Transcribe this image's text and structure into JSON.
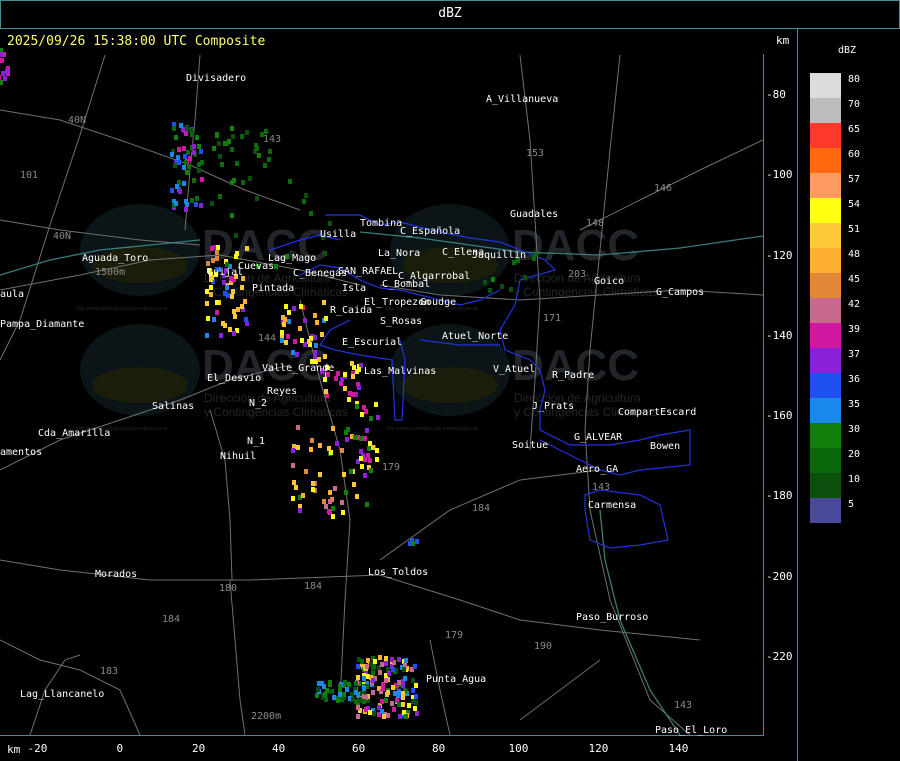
{
  "header": {
    "title": "dBZ"
  },
  "map": {
    "timestamp": "2025/09/26 15:38:00 UTC Composite",
    "y_axis": {
      "unit": "km",
      "ticks": [
        "-80",
        "-100",
        "-120",
        "-140",
        "-160",
        "-180",
        "-200",
        "-220"
      ]
    },
    "x_axis": {
      "unit": "km",
      "ticks": [
        "-20",
        "0",
        "20",
        "40",
        "60",
        "80",
        "100",
        "120",
        "140"
      ]
    },
    "watermark": {
      "logo_text": "DACC",
      "lines": [
        "Dirección de Agricultura",
        "y Contingencias Climáticas"
      ],
      "url": "http://www.contingencias.mendoza.gov.ar"
    },
    "places": [
      {
        "label": "Divisadero"
      },
      {
        "label": "A_Villanueva"
      },
      {
        "label": "Guadales"
      },
      {
        "label": "Tombina"
      },
      {
        "label": "Usilla"
      },
      {
        "label": "La_Nora"
      },
      {
        "label": "C_Española"
      },
      {
        "label": "C_Elena"
      },
      {
        "label": "Jaquillin"
      },
      {
        "label": "Aguada_Toro"
      },
      {
        "label": "Pampa_Diamante"
      },
      {
        "label": "C_Benegas"
      },
      {
        "label": "SAN_RAFAEL"
      },
      {
        "label": "C_Algarrobal"
      },
      {
        "label": "Isla"
      },
      {
        "label": "C_Bombal"
      },
      {
        "label": "Goico"
      },
      {
        "label": "G_Campos"
      },
      {
        "label": "Las_Malvinas"
      },
      {
        "label": "El_Tropezon"
      },
      {
        "label": "Goudge"
      },
      {
        "label": "R_Caida"
      },
      {
        "label": "S_Rosas"
      },
      {
        "label": "Atuel_Norte"
      },
      {
        "label": "E_Escurial"
      },
      {
        "label": "Valle_Grande"
      },
      {
        "label": "El_Desvio"
      },
      {
        "label": "V_Atuel"
      },
      {
        "label": "R_Padre"
      },
      {
        "label": "J_Prats"
      },
      {
        "label": "CompartEscard"
      },
      {
        "label": "G_ALVEAR"
      },
      {
        "label": "Bowen"
      },
      {
        "label": "Soitue"
      },
      {
        "label": "Aero_GA"
      },
      {
        "label": "Carmensa"
      },
      {
        "label": "Salinas"
      },
      {
        "label": "Cda_Amarilla"
      },
      {
        "label": "N_1"
      },
      {
        "label": "N_2"
      },
      {
        "label": "Nihuil"
      },
      {
        "label": "Los_Toldos"
      },
      {
        "label": "Morados"
      },
      {
        "label": "Paso_Burroso"
      },
      {
        "label": "Punta_Agua"
      },
      {
        "label": "Lag_Llancanelo"
      },
      {
        "label": "Paso_El_Loro"
      },
      {
        "label": "Pintada"
      },
      {
        "label": "Cuevas"
      },
      {
        "label": "Lag_Mago"
      },
      {
        "label": "Quijal"
      },
      {
        "label": "Reyes"
      },
      {
        "label": "aula"
      },
      {
        "label": "amentos"
      }
    ],
    "routes": [
      "143",
      "153",
      "146",
      "148",
      "203",
      "171",
      "101",
      "40N",
      "40N",
      "144",
      "180",
      "184",
      "184",
      "183",
      "179",
      "184",
      "190",
      "143",
      "143",
      "179",
      "1500m",
      "2200m"
    ]
  },
  "legend": {
    "title": "dBZ",
    "entries": [
      {
        "value": "80",
        "color": "#dcdcdc"
      },
      {
        "value": "70",
        "color": "#bcbcbc"
      },
      {
        "value": "65",
        "color": "#ff3a2a"
      },
      {
        "value": "60",
        "color": "#ff6a10"
      },
      {
        "value": "57",
        "color": "#ff9a60"
      },
      {
        "value": "54",
        "color": "#ffff10"
      },
      {
        "value": "51",
        "color": "#ffc83a"
      },
      {
        "value": "48",
        "color": "#ffb030"
      },
      {
        "value": "45",
        "color": "#e08838"
      },
      {
        "value": "42",
        "color": "#c86a90"
      },
      {
        "value": "39",
        "color": "#d018a0"
      },
      {
        "value": "37",
        "color": "#8a20d8"
      },
      {
        "value": "36",
        "color": "#2050f0"
      },
      {
        "value": "35",
        "color": "#1a88e8"
      },
      {
        "value": "30",
        "color": "#10800a"
      },
      {
        "value": "20",
        "color": "#0a6a0a"
      },
      {
        "value": "10",
        "color": "#0a500a"
      },
      {
        "value": "5",
        "color": "#4a4a9a"
      }
    ]
  }
}
